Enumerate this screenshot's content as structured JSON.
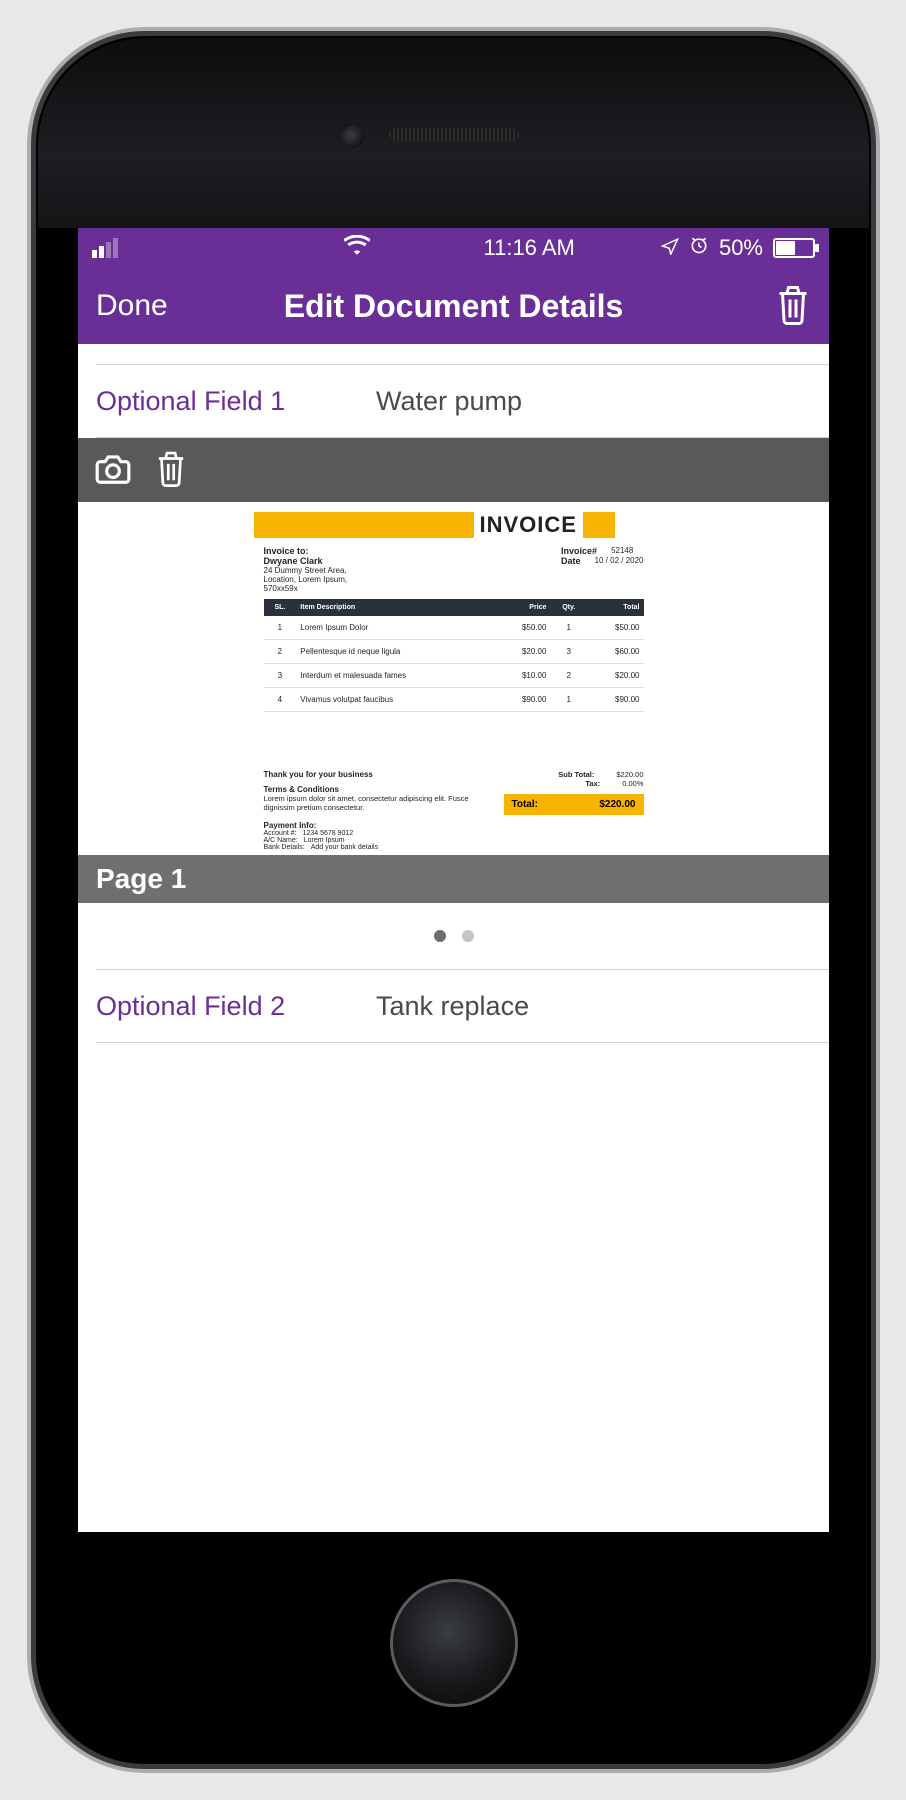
{
  "statusbar": {
    "time": "11:16 AM",
    "battery_pct": "50%"
  },
  "navbar": {
    "done_label": "Done",
    "title": "Edit Document Details"
  },
  "fields": {
    "opt1_label": "Optional Field 1",
    "opt1_value": "Water pump",
    "opt2_label": "Optional Field 2",
    "opt2_value": "Tank replace"
  },
  "page_band": "Page 1",
  "invoice_preview": {
    "title": "INVOICE",
    "to_heading": "Invoice to:",
    "to_name": "Dwyane Clark",
    "to_addr1": "24 Dummy Street Area,",
    "to_addr2": "Location, Lorem Ipsum,",
    "to_addr3": "570xx59x",
    "num_label": "Invoice#",
    "num_value": "52148",
    "date_label": "Date",
    "date_value": "10 / 02 / 2020",
    "cols": {
      "sl": "SL.",
      "desc": "Item Description",
      "price": "Price",
      "qty": "Qty.",
      "total": "Total"
    },
    "items": [
      {
        "sl": "1",
        "desc": "Lorem Ipsum Dolor",
        "price": "$50.00",
        "qty": "1",
        "total": "$50.00"
      },
      {
        "sl": "2",
        "desc": "Pellentesque id neque ligula",
        "price": "$20.00",
        "qty": "3",
        "total": "$60.00"
      },
      {
        "sl": "3",
        "desc": "Interdum et malesuada fames",
        "price": "$10.00",
        "qty": "2",
        "total": "$20.00"
      },
      {
        "sl": "4",
        "desc": "Vivamus volutpat faucibus",
        "price": "$90.00",
        "qty": "1",
        "total": "$90.00"
      }
    ],
    "thanks": "Thank you for your business",
    "terms_h": "Terms & Conditions",
    "terms_t": "Lorem ipsum dolor sit amet, consectetur adipiscing elit. Fusce dignissim pretium consectetur.",
    "sub_l": "Sub Total:",
    "sub_v": "$220.00",
    "tax_l": "Tax:",
    "tax_v": "0.00%",
    "tot_l": "Total:",
    "tot_v": "$220.00",
    "pay_h": "Payment Info:",
    "pay_acc_l": "Account #:",
    "pay_acc_v": "1234 5678 9012",
    "pay_an_l": "A/C Name:",
    "pay_an_v": "Lorem Ipsum",
    "pay_bd_l": "Bank Details:",
    "pay_bd_v": "Add your bank details"
  }
}
